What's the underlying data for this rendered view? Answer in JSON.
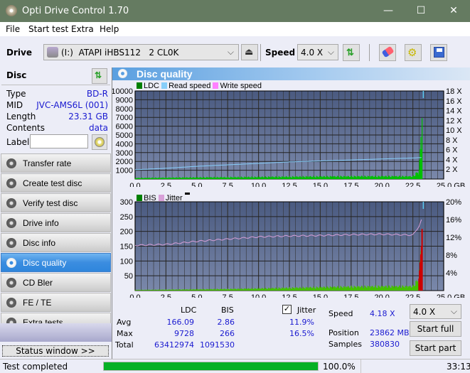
{
  "window": {
    "title": "Opti Drive Control 1.70",
    "minimize": "—",
    "maximize": "☐",
    "close": "✕"
  },
  "menu": [
    "File",
    "Start test",
    "Extra",
    "Help"
  ],
  "toolbar": {
    "drive_label": "Drive",
    "drive_value": "(I:)  ATAPI iHBS112   2 CL0K",
    "speed_label": "Speed",
    "speed_value": "4.0 X"
  },
  "disc": {
    "header": "Disc",
    "rows": [
      {
        "label": "Type",
        "value": "BD-R"
      },
      {
        "label": "MID",
        "value": "JVC-AMS6L (001)"
      },
      {
        "label": "Length",
        "value": "23.31 GB"
      },
      {
        "label": "Contents",
        "value": "data"
      }
    ],
    "label_label": "Label",
    "label_value": ""
  },
  "nav": [
    {
      "label": "Transfer rate",
      "active": false
    },
    {
      "label": "Create test disc",
      "active": false
    },
    {
      "label": "Verify test disc",
      "active": false
    },
    {
      "label": "Drive info",
      "active": false
    },
    {
      "label": "Disc info",
      "active": false
    },
    {
      "label": "Disc quality",
      "active": true
    },
    {
      "label": "CD Bler",
      "active": false
    },
    {
      "label": "FE / TE",
      "active": false
    },
    {
      "label": "Extra tests",
      "active": false
    }
  ],
  "status_window_label": "Status window >>",
  "panel_title": "Disc quality",
  "chart_data": [
    {
      "type": "line",
      "title": "LDC / Read speed",
      "legend": [
        {
          "name": "LDC",
          "color": "#008000"
        },
        {
          "name": "Read speed",
          "color": "#87cefa"
        },
        {
          "name": "Write speed",
          "color": "#ff80ff"
        }
      ],
      "x_ticks": [
        "0.0",
        "2.5",
        "5.0",
        "7.5",
        "10.0",
        "12.5",
        "15.0",
        "17.5",
        "20.0",
        "22.5",
        "25.0"
      ],
      "x_unit": "GB",
      "xlim": [
        0,
        25
      ],
      "y_ticks": [
        "10000",
        "9000",
        "8000",
        "7000",
        "6000",
        "5000",
        "4000",
        "3000",
        "2000",
        "1000"
      ],
      "ylim": [
        0,
        10000
      ],
      "y2_ticks": [
        "18 X",
        "16 X",
        "14 X",
        "12 X",
        "10 X",
        "8 X",
        "6 X",
        "4 X",
        "2 X"
      ],
      "y2lim": [
        0,
        18
      ],
      "series": [
        {
          "name": "Read speed",
          "x": [
            0,
            2.5,
            5,
            7.5,
            10,
            12.5,
            15,
            17.5,
            20,
            22.5,
            23.3
          ],
          "values": [
            1.9,
            2.2,
            2.6,
            2.9,
            3.2,
            3.5,
            3.7,
            3.9,
            4.1,
            4.3,
            4.4
          ]
        },
        {
          "name": "LDC",
          "x": [
            0,
            2.5,
            5,
            7.5,
            10,
            12.5,
            15,
            17.5,
            20,
            22.5,
            23.0,
            23.2,
            23.3
          ],
          "values": [
            120,
            150,
            180,
            200,
            230,
            260,
            280,
            300,
            310,
            300,
            900,
            5500,
            9728
          ]
        }
      ]
    },
    {
      "type": "line",
      "title": "BIS / Jitter",
      "legend": [
        {
          "name": "BIS",
          "color": "#008000"
        },
        {
          "name": "Jitter",
          "color": "#d8a0d8"
        }
      ],
      "x_ticks": [
        "0.0",
        "2.5",
        "5.0",
        "7.5",
        "10.0",
        "12.5",
        "15.0",
        "17.5",
        "20.0",
        "22.5",
        "25.0"
      ],
      "x_unit": "GB",
      "xlim": [
        0,
        25
      ],
      "y_ticks": [
        "300",
        "250",
        "200",
        "150",
        "100",
        "50"
      ],
      "ylim": [
        0,
        300
      ],
      "y2_ticks": [
        "20%",
        "16%",
        "12%",
        "8%",
        "4%"
      ],
      "y2lim": [
        0,
        20
      ],
      "series": [
        {
          "name": "Jitter",
          "x": [
            0,
            2.5,
            5,
            7.5,
            10,
            12.5,
            15,
            17.5,
            20,
            22.5,
            23.0,
            23.3
          ],
          "values": [
            10.2,
            10.4,
            11.1,
            11.6,
            12.1,
            12.3,
            12.4,
            12.6,
            12.7,
            12.5,
            14.5,
            16.5
          ]
        },
        {
          "name": "BIS",
          "x": [
            0,
            2.5,
            5,
            7.5,
            10,
            12.5,
            15,
            17.5,
            20,
            22.5,
            23.0,
            23.2,
            23.3
          ],
          "values": [
            2,
            3,
            4,
            5,
            7,
            9,
            11,
            13,
            14,
            14,
            40,
            150,
            266
          ]
        }
      ]
    }
  ],
  "stats": {
    "col_ldc": "LDC",
    "col_bis": "BIS",
    "jitter_label": "Jitter",
    "jitter_checked": true,
    "rows": [
      {
        "label": "Avg",
        "ldc": "166.09",
        "bis": "2.86",
        "jitter": "11.9%"
      },
      {
        "label": "Max",
        "ldc": "9728",
        "bis": "266",
        "jitter": "16.5%"
      },
      {
        "label": "Total",
        "ldc": "63412974",
        "bis": "1091530",
        "jitter": ""
      }
    ],
    "speed_label": "Speed",
    "speed_value": "4.18 X",
    "position_label": "Position",
    "position_value": "23862 MB",
    "samples_label": "Samples",
    "samples_value": "380830",
    "speed_select": "4.0 X",
    "start_full": "Start full",
    "start_part": "Start part"
  },
  "statusbar": {
    "text": "Test completed",
    "progress": 100.0,
    "progress_text": "100.0%",
    "time": "33:13"
  }
}
